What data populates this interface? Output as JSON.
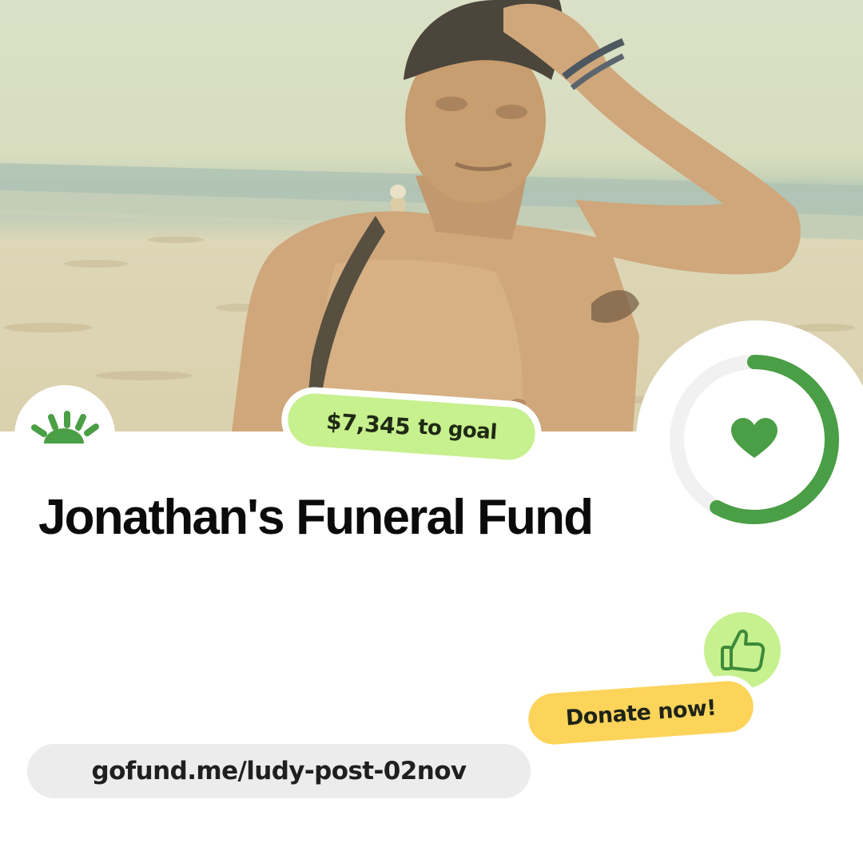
{
  "fundraiser": {
    "title": "Jonathan's Funeral Fund",
    "goal_amount": "$7,345",
    "goal_suffix": "to goal",
    "progress_fraction": 0.58,
    "donate_label": "Donate now!",
    "url": "gofund.me/ludy-post-02nov"
  },
  "photo": {
    "subject": "person-on-beach"
  },
  "icons": {
    "logo": "gofundme-sunrise-icon",
    "progress_center": "heart-icon",
    "badge": "thumbs-up-icon"
  },
  "colors": {
    "brand_green": "#4a9e45",
    "goal_pill_green": "#c7f08e",
    "donate_yellow": "#fcd45a",
    "ring_track": "#f1f1f1",
    "url_pill_gray": "#ececec",
    "title_text": "#0b0b0b"
  }
}
